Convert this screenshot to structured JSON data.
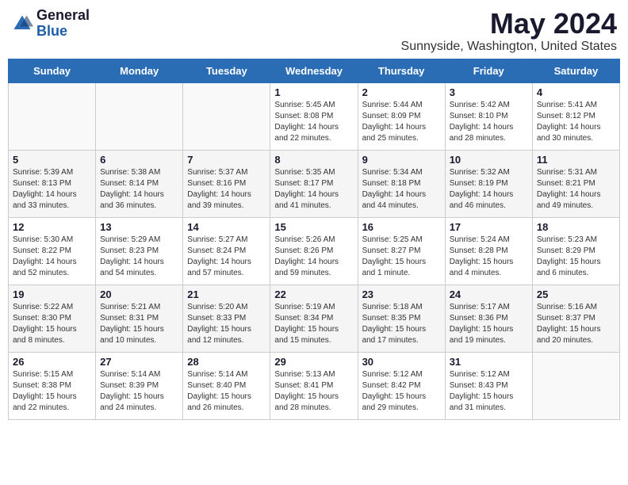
{
  "header": {
    "logo_general": "General",
    "logo_blue": "Blue",
    "month_title": "May 2024",
    "location": "Sunnyside, Washington, United States"
  },
  "days_of_week": [
    "Sunday",
    "Monday",
    "Tuesday",
    "Wednesday",
    "Thursday",
    "Friday",
    "Saturday"
  ],
  "weeks": [
    [
      {
        "day": "",
        "info": ""
      },
      {
        "day": "",
        "info": ""
      },
      {
        "day": "",
        "info": ""
      },
      {
        "day": "1",
        "info": "Sunrise: 5:45 AM\nSunset: 8:08 PM\nDaylight: 14 hours\nand 22 minutes."
      },
      {
        "day": "2",
        "info": "Sunrise: 5:44 AM\nSunset: 8:09 PM\nDaylight: 14 hours\nand 25 minutes."
      },
      {
        "day": "3",
        "info": "Sunrise: 5:42 AM\nSunset: 8:10 PM\nDaylight: 14 hours\nand 28 minutes."
      },
      {
        "day": "4",
        "info": "Sunrise: 5:41 AM\nSunset: 8:12 PM\nDaylight: 14 hours\nand 30 minutes."
      }
    ],
    [
      {
        "day": "5",
        "info": "Sunrise: 5:39 AM\nSunset: 8:13 PM\nDaylight: 14 hours\nand 33 minutes."
      },
      {
        "day": "6",
        "info": "Sunrise: 5:38 AM\nSunset: 8:14 PM\nDaylight: 14 hours\nand 36 minutes."
      },
      {
        "day": "7",
        "info": "Sunrise: 5:37 AM\nSunset: 8:16 PM\nDaylight: 14 hours\nand 39 minutes."
      },
      {
        "day": "8",
        "info": "Sunrise: 5:35 AM\nSunset: 8:17 PM\nDaylight: 14 hours\nand 41 minutes."
      },
      {
        "day": "9",
        "info": "Sunrise: 5:34 AM\nSunset: 8:18 PM\nDaylight: 14 hours\nand 44 minutes."
      },
      {
        "day": "10",
        "info": "Sunrise: 5:32 AM\nSunset: 8:19 PM\nDaylight: 14 hours\nand 46 minutes."
      },
      {
        "day": "11",
        "info": "Sunrise: 5:31 AM\nSunset: 8:21 PM\nDaylight: 14 hours\nand 49 minutes."
      }
    ],
    [
      {
        "day": "12",
        "info": "Sunrise: 5:30 AM\nSunset: 8:22 PM\nDaylight: 14 hours\nand 52 minutes."
      },
      {
        "day": "13",
        "info": "Sunrise: 5:29 AM\nSunset: 8:23 PM\nDaylight: 14 hours\nand 54 minutes."
      },
      {
        "day": "14",
        "info": "Sunrise: 5:27 AM\nSunset: 8:24 PM\nDaylight: 14 hours\nand 57 minutes."
      },
      {
        "day": "15",
        "info": "Sunrise: 5:26 AM\nSunset: 8:26 PM\nDaylight: 14 hours\nand 59 minutes."
      },
      {
        "day": "16",
        "info": "Sunrise: 5:25 AM\nSunset: 8:27 PM\nDaylight: 15 hours\nand 1 minute."
      },
      {
        "day": "17",
        "info": "Sunrise: 5:24 AM\nSunset: 8:28 PM\nDaylight: 15 hours\nand 4 minutes."
      },
      {
        "day": "18",
        "info": "Sunrise: 5:23 AM\nSunset: 8:29 PM\nDaylight: 15 hours\nand 6 minutes."
      }
    ],
    [
      {
        "day": "19",
        "info": "Sunrise: 5:22 AM\nSunset: 8:30 PM\nDaylight: 15 hours\nand 8 minutes."
      },
      {
        "day": "20",
        "info": "Sunrise: 5:21 AM\nSunset: 8:31 PM\nDaylight: 15 hours\nand 10 minutes."
      },
      {
        "day": "21",
        "info": "Sunrise: 5:20 AM\nSunset: 8:33 PM\nDaylight: 15 hours\nand 12 minutes."
      },
      {
        "day": "22",
        "info": "Sunrise: 5:19 AM\nSunset: 8:34 PM\nDaylight: 15 hours\nand 15 minutes."
      },
      {
        "day": "23",
        "info": "Sunrise: 5:18 AM\nSunset: 8:35 PM\nDaylight: 15 hours\nand 17 minutes."
      },
      {
        "day": "24",
        "info": "Sunrise: 5:17 AM\nSunset: 8:36 PM\nDaylight: 15 hours\nand 19 minutes."
      },
      {
        "day": "25",
        "info": "Sunrise: 5:16 AM\nSunset: 8:37 PM\nDaylight: 15 hours\nand 20 minutes."
      }
    ],
    [
      {
        "day": "26",
        "info": "Sunrise: 5:15 AM\nSunset: 8:38 PM\nDaylight: 15 hours\nand 22 minutes."
      },
      {
        "day": "27",
        "info": "Sunrise: 5:14 AM\nSunset: 8:39 PM\nDaylight: 15 hours\nand 24 minutes."
      },
      {
        "day": "28",
        "info": "Sunrise: 5:14 AM\nSunset: 8:40 PM\nDaylight: 15 hours\nand 26 minutes."
      },
      {
        "day": "29",
        "info": "Sunrise: 5:13 AM\nSunset: 8:41 PM\nDaylight: 15 hours\nand 28 minutes."
      },
      {
        "day": "30",
        "info": "Sunrise: 5:12 AM\nSunset: 8:42 PM\nDaylight: 15 hours\nand 29 minutes."
      },
      {
        "day": "31",
        "info": "Sunrise: 5:12 AM\nSunset: 8:43 PM\nDaylight: 15 hours\nand 31 minutes."
      },
      {
        "day": "",
        "info": ""
      }
    ]
  ]
}
